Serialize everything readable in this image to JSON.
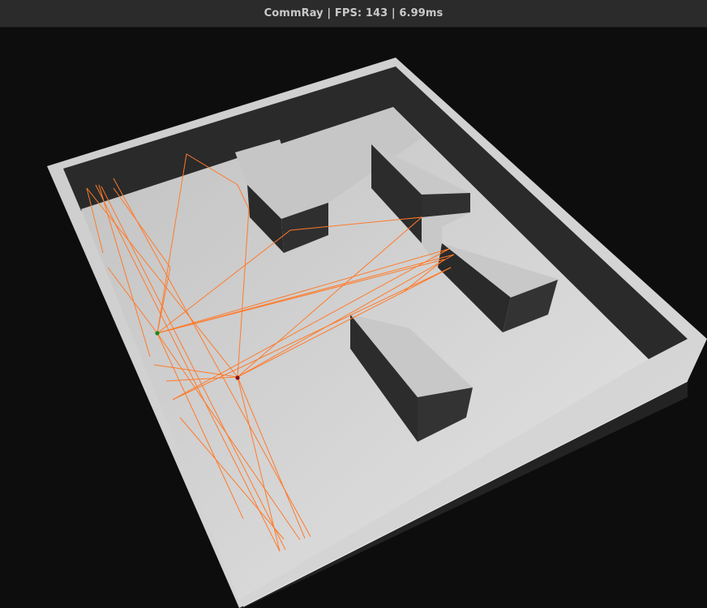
{
  "window": {
    "title": "CommRay | FPS: 143 | 6.99ms"
  },
  "scene": {
    "background_color": "#0d0d0d",
    "floor_color": "#d4d4d4",
    "wall_top_color": "#c8c8c8",
    "wall_side_color": "#2a2a2a",
    "ray_color": "#ff7a2a",
    "transmitter_color": "#1a8a1a",
    "receiver_color": "#8a1010"
  }
}
